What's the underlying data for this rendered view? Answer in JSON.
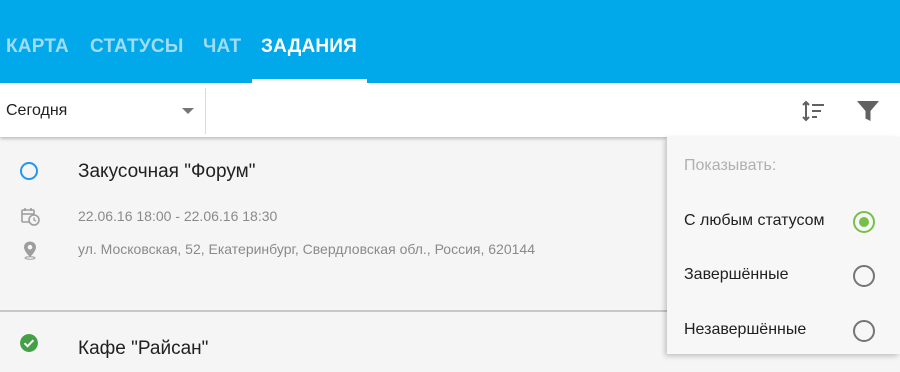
{
  "tabs": [
    {
      "label": "КАРТА"
    },
    {
      "label": "СТАТУСЫ"
    },
    {
      "label": "ЧАТ"
    },
    {
      "label": "ЗАДАНИЯ"
    }
  ],
  "active_tab": "ЗАДАНИЯ",
  "toolbar": {
    "date_filter": "Сегодня"
  },
  "tasks": [
    {
      "title": "Закусочная \"Форум\"",
      "time": "22.06.16 18:00 - 22.06.16 18:30",
      "address": "ул. Московская, 52, Екатеринбург, Свердловская обл., Россия, 620144",
      "status": "open"
    },
    {
      "title": "Кафе \"Райсан\"",
      "status": "done"
    }
  ],
  "filter_panel": {
    "heading": "Показывать:",
    "options": [
      {
        "label": "С любым статусом",
        "selected": true
      },
      {
        "label": "Завершённые",
        "selected": false
      },
      {
        "label": "Незавершённые",
        "selected": false
      }
    ]
  },
  "colors": {
    "app_bar": "#02a9ea",
    "tab_inactive": "#9fdcf5",
    "status_open": "#2196f3",
    "status_done": "#43a047",
    "radio_selected": "#76c04a"
  }
}
